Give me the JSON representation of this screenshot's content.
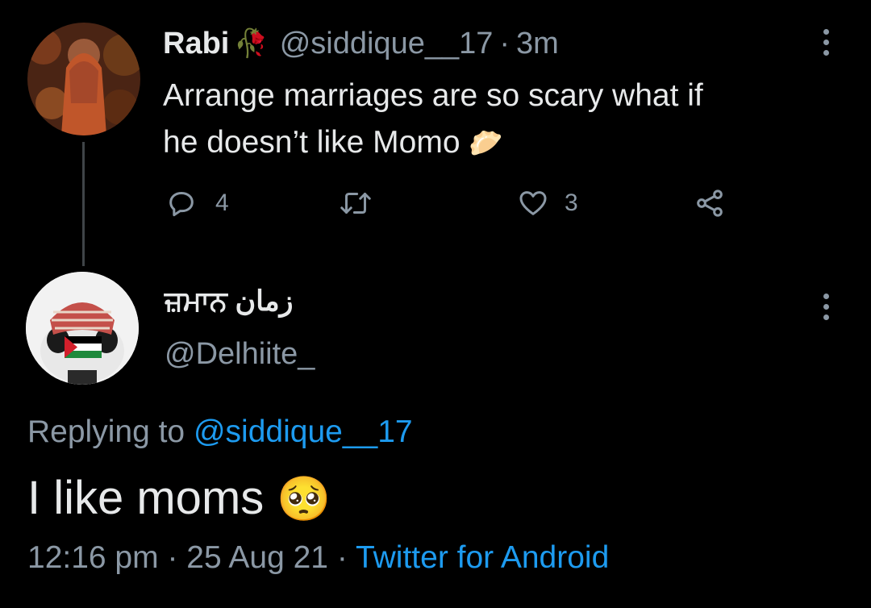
{
  "original_tweet": {
    "author_name": "Rabi",
    "name_emoji": "🥀",
    "handle": "@siddique__17",
    "separator": "·",
    "time_ago": "3m",
    "text_line1": "Arrange marriages are so scary what if",
    "text_line2": "he doesn’t like Momo",
    "text_emoji": "🥟",
    "replies_count": "4",
    "likes_count": "3",
    "icons": [
      "reply-icon",
      "retweet-icon",
      "like-icon",
      "share-icon",
      "more-icon"
    ]
  },
  "reply_tweet": {
    "author_name": "ਜ਼ਮਾਨ زمان",
    "handle": "@Delhiite_",
    "replying_prefix": "Replying to",
    "replying_handle": "@siddique__17",
    "text": "I like moms",
    "text_emoji": "🥺",
    "time": "12:16 pm",
    "separator": "·",
    "date": "25 Aug 21",
    "separator2": "·",
    "client": "Twitter for Android"
  },
  "colors": {
    "background": "#000000",
    "text": "#e7e9ea",
    "secondary": "#8b98a5",
    "accent": "#1d9bf0"
  }
}
